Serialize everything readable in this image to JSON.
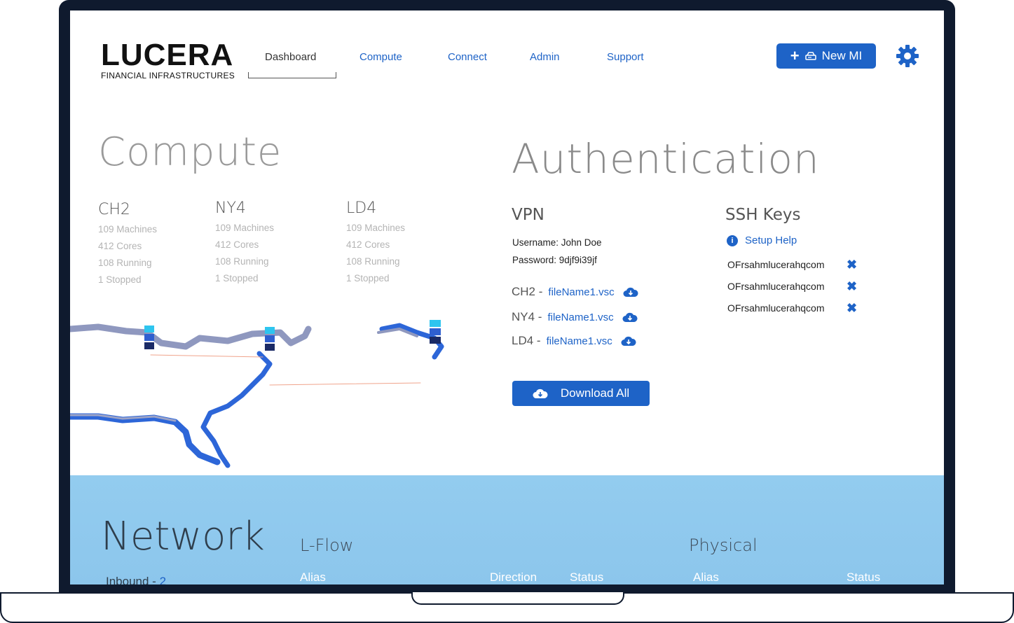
{
  "brand": {
    "name": "LUCERA",
    "tagline": "FINANCIAL INFRASTRUCTURES"
  },
  "nav": {
    "items": [
      {
        "label": "Dashboard",
        "active": true
      },
      {
        "label": "Compute",
        "active": false
      },
      {
        "label": "Connect",
        "active": false
      },
      {
        "label": "Admin",
        "active": false
      },
      {
        "label": "Support",
        "active": false
      }
    ]
  },
  "header": {
    "new_button_label": "New MI"
  },
  "compute": {
    "title": "Compute",
    "regions": [
      {
        "name": "CH2",
        "machines": "109 Machines",
        "cores": "412 Cores",
        "running": "108 Running",
        "stopped": "1 Stopped"
      },
      {
        "name": "NY4",
        "machines": "109 Machines",
        "cores": "412 Cores",
        "running": "108 Running",
        "stopped": "1 Stopped"
      },
      {
        "name": "LD4",
        "machines": "109 Machines",
        "cores": "412 Cores",
        "running": "108 Running",
        "stopped": "1 Stopped"
      }
    ]
  },
  "authentication": {
    "title": "Authentication",
    "vpn": {
      "title": "VPN",
      "username": "Username: John Doe",
      "password": "Password: 9djf9i39jf",
      "files": [
        {
          "region": "CH2 -",
          "file": "fileName1.vsc"
        },
        {
          "region": "NY4 -",
          "file": "fileName1.vsc"
        },
        {
          "region": "LD4 -",
          "file": "fileName1.vsc"
        }
      ],
      "download_all_label": "Download All"
    },
    "ssh": {
      "title": "SSH Keys",
      "setup_help": "Setup Help",
      "keys": [
        "OFrsahmlucerahqcom",
        "OFrsahmlucerahqcom",
        "OFrsahmlucerahqcom"
      ]
    }
  },
  "network": {
    "title": "Network",
    "inbound_label": "Inbound -",
    "inbound_count": "2",
    "lflow": {
      "title": "L-Flow",
      "columns": [
        "Alias",
        "Direction",
        "Status"
      ]
    },
    "physical": {
      "title": "Physical",
      "columns": [
        "Alias",
        "Status"
      ]
    }
  },
  "colors": {
    "accent": "#1e63c7",
    "network_bg": "#93ccef",
    "frame": "#0f1a2e"
  }
}
